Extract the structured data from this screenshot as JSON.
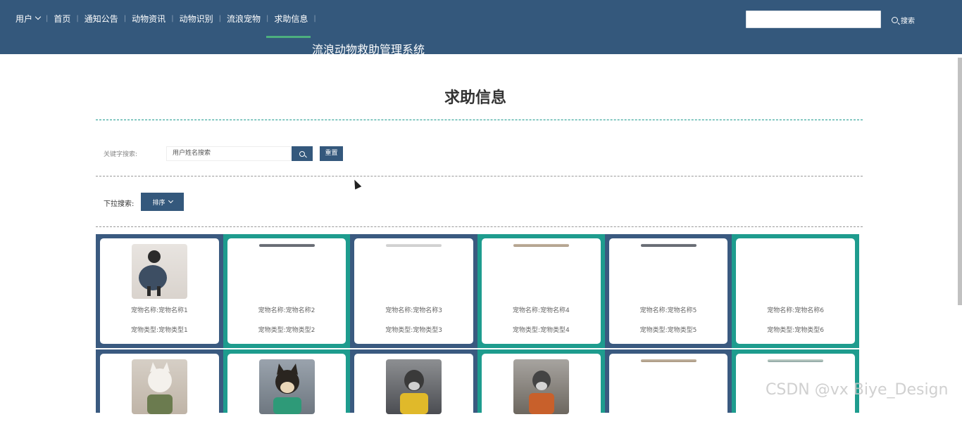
{
  "nav": {
    "user_label": "用户",
    "items": [
      {
        "label": "首页"
      },
      {
        "label": "通知公告"
      },
      {
        "label": "动物资讯"
      },
      {
        "label": "动物识别"
      },
      {
        "label": "流浪宠物"
      },
      {
        "label": "求助信息"
      }
    ],
    "site_title": "流浪动物救助管理系统",
    "search_input_value": "",
    "search_label": "搜索"
  },
  "page": {
    "title": "求助信息",
    "keyword_label": "关键字搜索:",
    "keyword_placeholder": "用户姓名搜索",
    "reset_label": "重置",
    "dropdown_label": "下拉搜索:",
    "sort_label": "排序"
  },
  "cards": [
    {
      "name": "宠物名称:宠物名称1",
      "type": "宠物类型:宠物类型1"
    },
    {
      "name": "宠物名称:宠物名称2",
      "type": "宠物类型:宠物类型2"
    },
    {
      "name": "宠物名称:宠物名称3",
      "type": "宠物类型:宠物类型3"
    },
    {
      "name": "宠物名称:宠物名称4",
      "type": "宠物类型:宠物类型4"
    },
    {
      "name": "宠物名称:宠物名称5",
      "type": "宠物类型:宠物类型5"
    },
    {
      "name": "宠物名称:宠物名称6",
      "type": "宠物类型:宠物类型6"
    }
  ],
  "watermark": "CSDN @vx Biye_Design",
  "colors": {
    "header_bg": "#34587c",
    "active_underline": "#4caf7e",
    "teal": "#1e9c8e",
    "navy": "#3a5a80"
  }
}
